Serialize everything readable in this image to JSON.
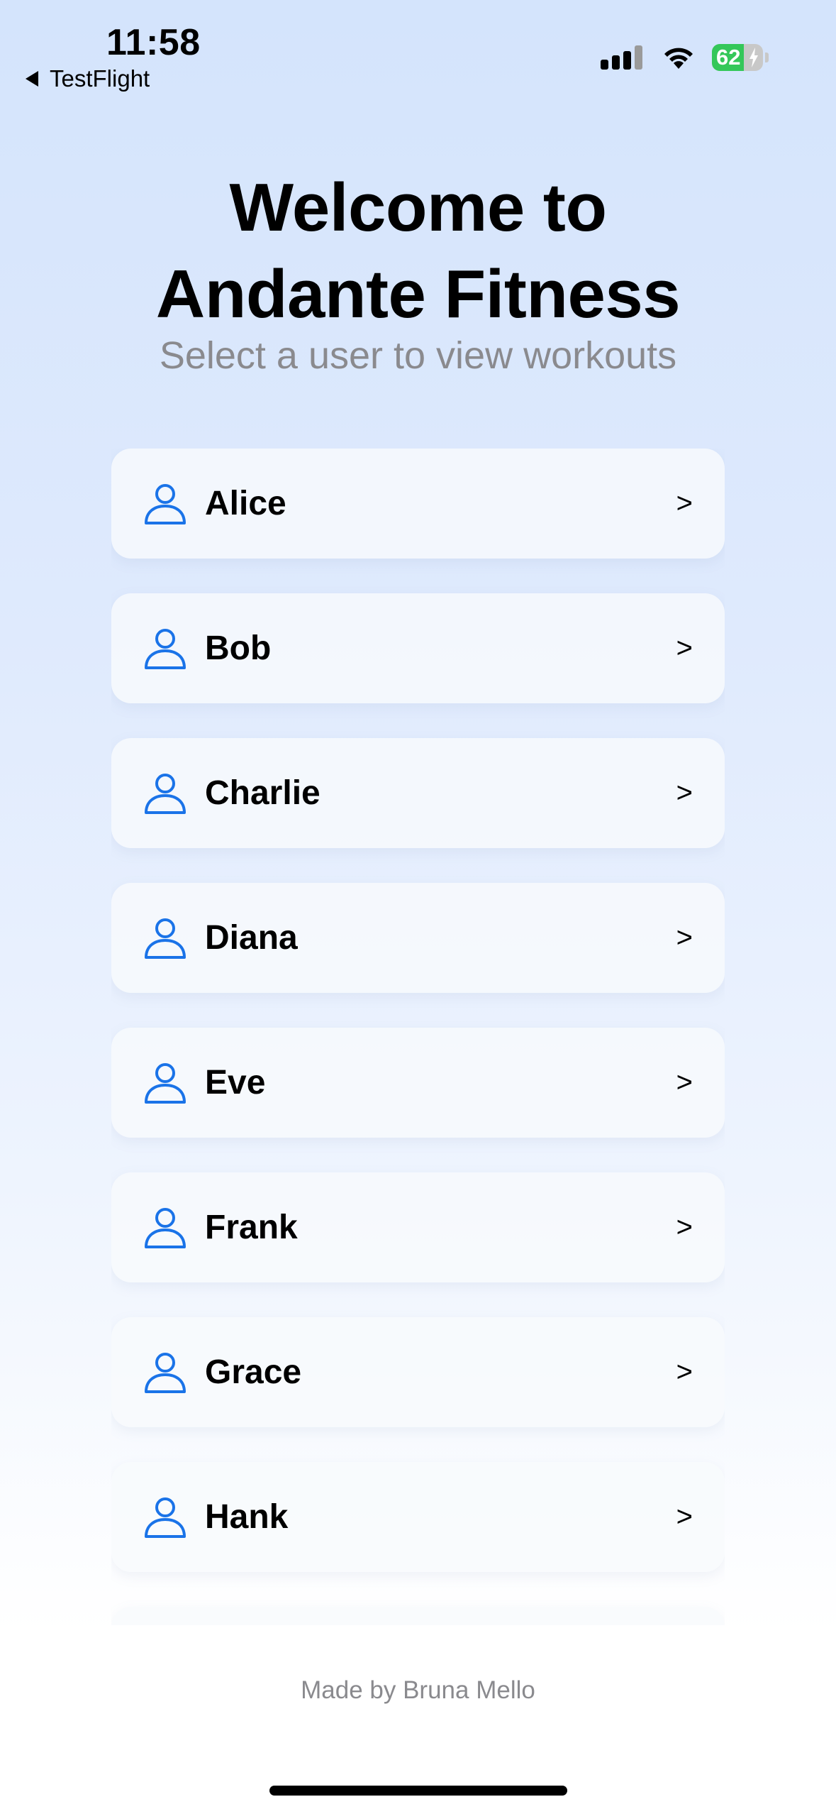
{
  "status_bar": {
    "time": "11:58",
    "back_label": "TestFlight",
    "battery_percent": "62"
  },
  "header": {
    "title_line1": "Welcome to",
    "title_line2": "Andante Fitness",
    "subtitle": "Select a user to view workouts"
  },
  "users": [
    {
      "name": "Alice",
      "chevron": ">"
    },
    {
      "name": "Bob",
      "chevron": ">"
    },
    {
      "name": "Charlie",
      "chevron": ">"
    },
    {
      "name": "Diana",
      "chevron": ">"
    },
    {
      "name": "Eve",
      "chevron": ">"
    },
    {
      "name": "Frank",
      "chevron": ">"
    },
    {
      "name": "Grace",
      "chevron": ">"
    },
    {
      "name": "Hank",
      "chevron": ">"
    },
    {
      "name": "",
      "chevron": ""
    }
  ],
  "footer": {
    "credit": "Made by Bruna Mello"
  },
  "icons": {
    "user": "person-icon",
    "back": "back-triangle-icon",
    "signal": "cellular-signal-icon",
    "wifi": "wifi-icon",
    "battery": "battery-charging-icon"
  },
  "colors": {
    "accent": "#1a73e8",
    "battery_green": "#34c759",
    "subtitle_gray": "#8a8a8e"
  }
}
